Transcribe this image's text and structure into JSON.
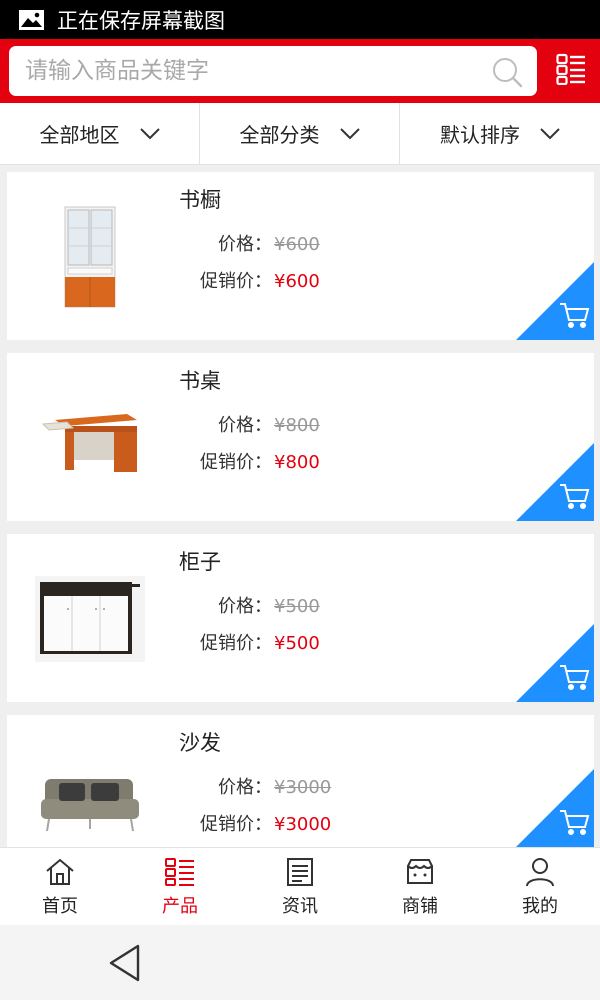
{
  "status_bar": {
    "text": "正在保存屏幕截图",
    "icon": "image-icon"
  },
  "search": {
    "placeholder": "请输入商品关键字",
    "value": ""
  },
  "header": {
    "accent": "#e3000f",
    "right_icon": "grid-menu-icon"
  },
  "filters": [
    {
      "label": "全部地区"
    },
    {
      "label": "全部分类"
    },
    {
      "label": "默认排序"
    }
  ],
  "products": [
    {
      "name": "书橱",
      "price_label": "价格：",
      "price": "¥600",
      "sale_label": "促销价：",
      "sale_price": "¥600",
      "image": "bookcase"
    },
    {
      "name": "书桌",
      "price_label": "价格：",
      "price": "¥800",
      "sale_label": "促销价：",
      "sale_price": "¥800",
      "image": "desk"
    },
    {
      "name": "柜子",
      "price_label": "价格：",
      "price": "¥500",
      "sale_label": "促销价：",
      "sale_price": "¥500",
      "image": "cabinet"
    },
    {
      "name": "沙发",
      "price_label": "价格：",
      "price": "¥3000",
      "sale_label": "促销价：",
      "sale_price": "¥3000",
      "image": "sofa"
    }
  ],
  "cart_corner_color": "#1e90ff",
  "bottom_nav": [
    {
      "label": "首页",
      "icon": "home-icon",
      "active": false
    },
    {
      "label": "产品",
      "icon": "product-list-icon",
      "active": true
    },
    {
      "label": "资讯",
      "icon": "news-icon",
      "active": false
    },
    {
      "label": "商铺",
      "icon": "shop-icon",
      "active": false
    },
    {
      "label": "我的",
      "icon": "user-icon",
      "active": false
    }
  ]
}
